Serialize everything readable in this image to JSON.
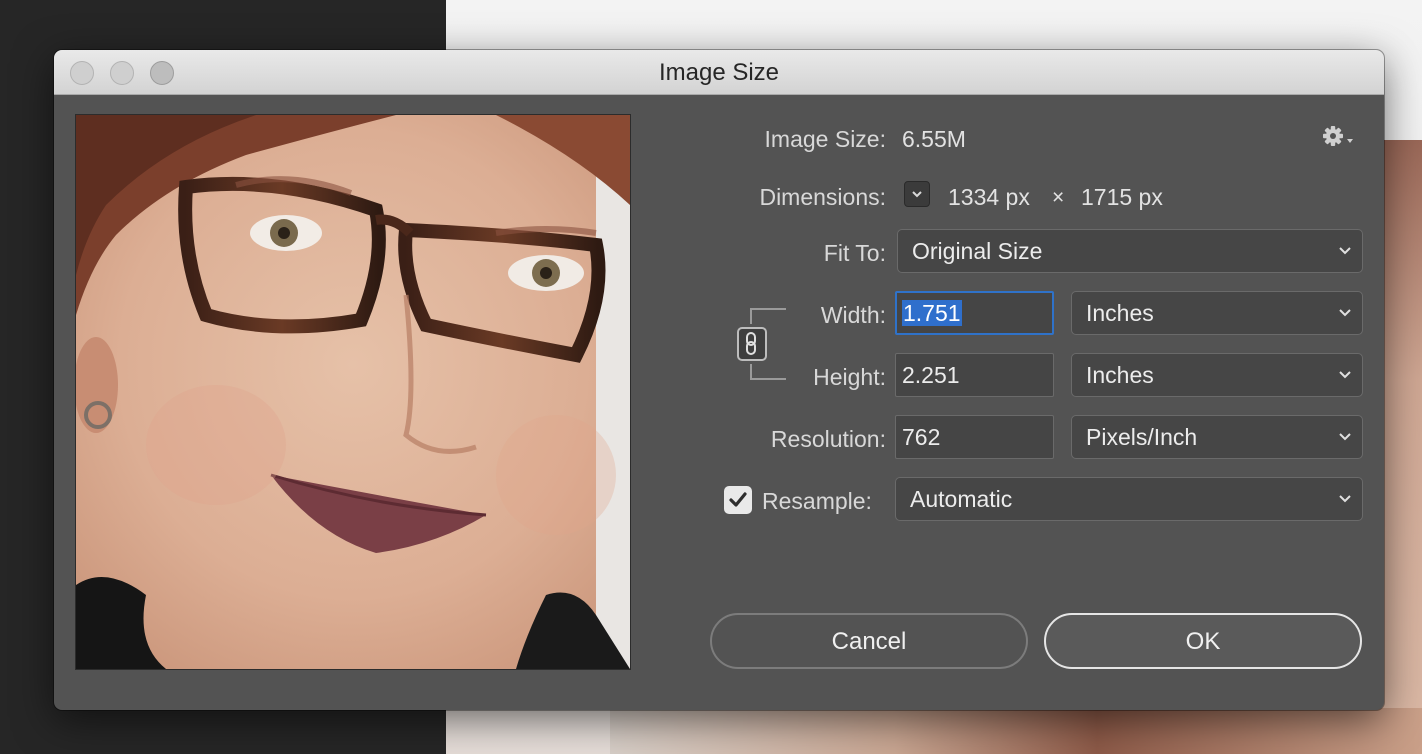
{
  "dialog": {
    "title": "Image Size"
  },
  "info": {
    "image_size_label": "Image Size:",
    "image_size_value": "6.55M",
    "dimensions_label": "Dimensions:",
    "width_px": "1334 px",
    "times": "×",
    "height_px": "1715 px"
  },
  "fit_to": {
    "label": "Fit To:",
    "value": "Original Size"
  },
  "width": {
    "label": "Width:",
    "value": "1.751",
    "unit": "Inches"
  },
  "height": {
    "label": "Height:",
    "value": "2.251",
    "unit": "Inches"
  },
  "resolution": {
    "label": "Resolution:",
    "value": "762",
    "unit": "Pixels/Inch"
  },
  "resample": {
    "label": "Resample:",
    "value": "Automatic",
    "checked": true
  },
  "buttons": {
    "cancel": "Cancel",
    "ok": "OK"
  },
  "icons": {
    "settings": "gear-icon",
    "dimensions_menu": "chevron-down-icon",
    "constrain": "chain-link-icon",
    "check": "checkmark-icon"
  },
  "colors": {
    "dialog_bg": "#535353",
    "focus_ring": "#2f72c9",
    "selection": "#2f6fcc"
  }
}
